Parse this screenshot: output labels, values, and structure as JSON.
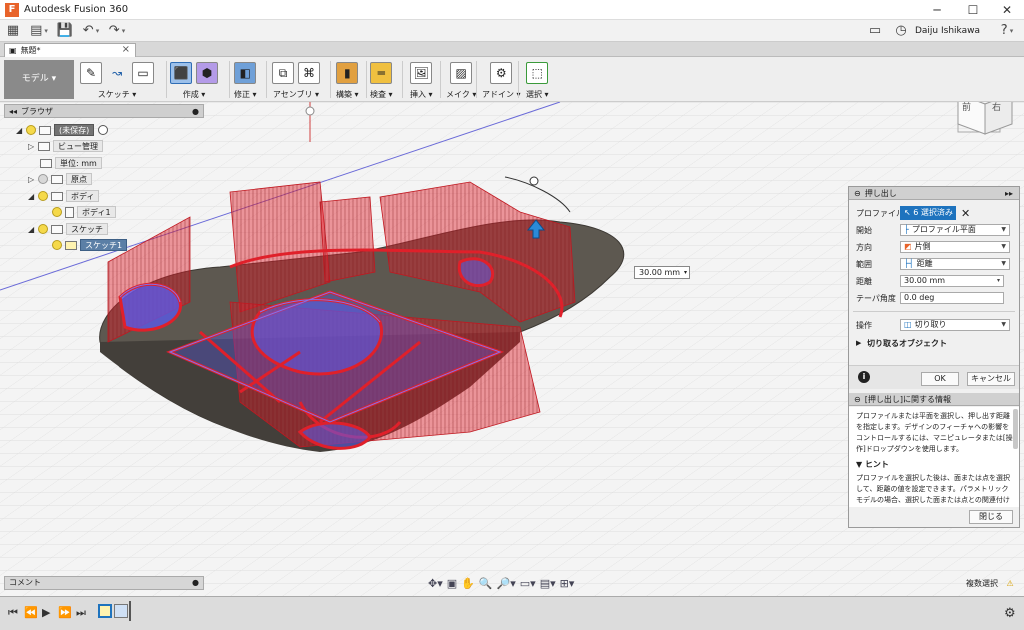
{
  "window": {
    "title": "Autodesk Fusion 360",
    "controls": [
      "─",
      "☐",
      "✕"
    ]
  },
  "appbar": {
    "user": "Daiju Ishikawa",
    "help": "?"
  },
  "doc_tab": {
    "label": "無題*",
    "close": "×"
  },
  "toolbar": {
    "workspace": "モデル ▾",
    "groups": [
      {
        "label": "スケッチ ▾"
      },
      {
        "label": "作成 ▾"
      },
      {
        "label": "修正 ▾"
      },
      {
        "label": "アセンブリ ▾"
      },
      {
        "label": "構築 ▾"
      },
      {
        "label": "検査 ▾"
      },
      {
        "label": "挿入 ▾"
      },
      {
        "label": "メイク ▾"
      },
      {
        "label": "アドイン ▾"
      },
      {
        "label": "選択 ▾"
      }
    ]
  },
  "browser": {
    "title": "ブラウザ",
    "root": "(未保存)",
    "items": [
      {
        "label": "ビュー管理"
      },
      {
        "label": "単位: mm"
      },
      {
        "label": "原点"
      },
      {
        "label": "ボディ"
      },
      {
        "label": "ボディ1"
      },
      {
        "label": "スケッチ"
      },
      {
        "label": "スケッチ1"
      }
    ]
  },
  "viewcube": {
    "front": "前",
    "right": "右"
  },
  "distance_input": "30.00 mm",
  "extrude_panel": {
    "title": "押し出し",
    "rows": [
      {
        "label": "プロファイル",
        "value": "6 選択済み"
      },
      {
        "label": "開始",
        "value": "プロファイル平面"
      },
      {
        "label": "方向",
        "value": "片側"
      },
      {
        "label": "範囲",
        "value": "距離"
      },
      {
        "label": "距離",
        "value": "30.00 mm"
      },
      {
        "label": "テーパ角度",
        "value": "0.0 deg"
      },
      {
        "label": "操作",
        "value": "切り取り"
      }
    ],
    "cut_objects": "切り取るオブジェクト",
    "ok": "OK",
    "cancel": "キャンセル",
    "info_title": "[押し出し]に関する情報",
    "info_body": "プロファイルまたは平面を選択し、押し出す距離を指定します。デザインのフィーチャへの影響をコントロールするには、マニピュレータまたは[操作]ドロップダウンを使用します。",
    "hint_title": "ヒント",
    "hint_body": "プロファイルを選択した後は、面または点を選択して、距離の値を設定できます。パラメトリック モデルの場合、選択した面または点との関連付けを維持す",
    "close": "閉じる"
  },
  "comments": {
    "label": "コメント"
  },
  "status": {
    "label": "複数選択"
  },
  "colors": {
    "accent": "#1e73be",
    "extrude": "#e0202a",
    "profile": "#5a5af0",
    "plate": "#5d5850"
  }
}
